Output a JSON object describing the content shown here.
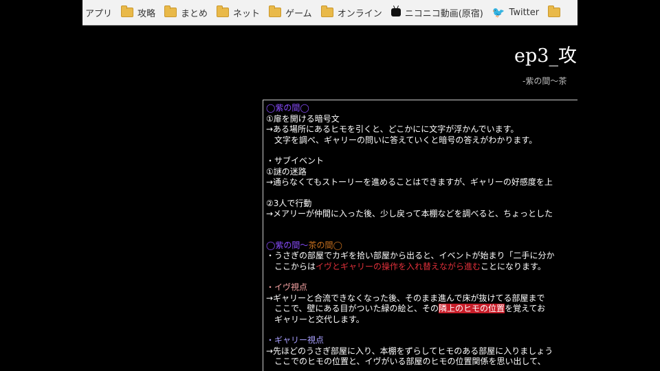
{
  "bookmarks": [
    {
      "label": "アプリ",
      "icon": "none"
    },
    {
      "label": "攻略",
      "icon": "folder-icon"
    },
    {
      "label": "まとめ",
      "icon": "folder-icon"
    },
    {
      "label": "ネット",
      "icon": "folder-icon"
    },
    {
      "label": "ゲーム",
      "icon": "folder-icon"
    },
    {
      "label": "オンライン",
      "icon": "folder-icon"
    },
    {
      "label": "ニコニコ動画(原宿)",
      "icon": "niconico-tv-icon"
    },
    {
      "label": "Twitter",
      "icon": "twitter-bird-icon"
    }
  ],
  "page": {
    "title": "ep3_攻",
    "subtitle": "-紫の間～茶"
  },
  "guide": {
    "s1_heading": "◯紫の間◯",
    "s1_l1": "①扉を開ける暗号文",
    "s1_l2": "→ある場所にあるヒモを引くと、どこかにに文字が浮かんでいます。",
    "s1_l3": "文字を調べ、ギャリーの問いに答えていくと暗号の答えがわかります。",
    "s1_sub_heading": "・サブイベント",
    "s1_l4": "①謎の迷路",
    "s1_l5": "→通らなくてもストーリーを進めることはできますが、ギャリーの好感度を上",
    "s1_l6": "②3人で行動",
    "s1_l7": "→メアリーが仲間に入った後、少し戻って本棚などを調べると、ちょっとした",
    "s2_heading_a": "◯紫の間～",
    "s2_heading_b": "茶の間◯",
    "s2_l1": "・うさぎの部屋でカギを拾い部屋から出ると、イベントが始まり「二手に分か",
    "s2_l2a": "ここからは",
    "s2_l2b": "イヴとギャリーの操作を入れ替えながら進む",
    "s2_l2c": "ことになります。",
    "s2_eve_heading": "・イヴ視点",
    "s2_eve_l1": "→ギャリーと合流できなくなった後、そのまま進んで床が抜けてる部屋まで",
    "s2_eve_l2a": "ここで、壁にある目がついた緑の絵と、その",
    "s2_eve_l2b": "隣上のヒモの位置",
    "s2_eve_l2c": "を覚えてお",
    "s2_eve_l3": "ギャリーと交代します。",
    "s2_gary_heading": "・ギャリー視点",
    "s2_gary_l1": "→先ほどのうさぎ部屋に入り、本棚をずらしてヒモのある部屋に入りましょう",
    "s2_gary_l2": "ここでのヒモの位置と、イヴがいる部屋のヒモの位置関係を思い出して、"
  }
}
